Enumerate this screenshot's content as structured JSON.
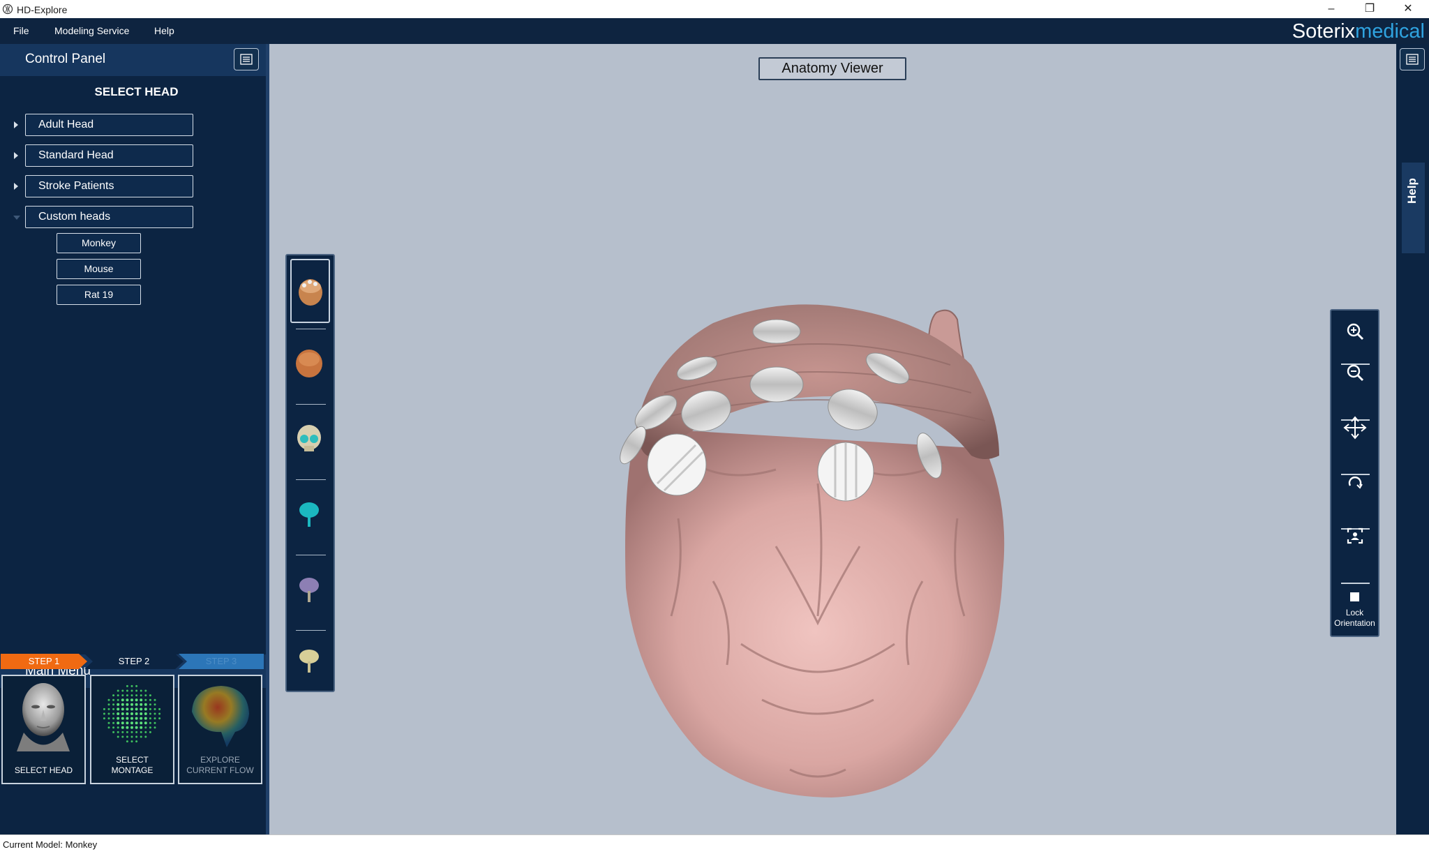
{
  "window": {
    "title": "HD-Explore",
    "controls": [
      "–",
      "❐",
      "✕"
    ]
  },
  "menubar": {
    "items": [
      "File",
      "Modeling Service",
      "Help"
    ],
    "brand_part1": "Soterix",
    "brand_part2": "medical",
    "brand_colors": {
      "part1": "#ffffff",
      "part2": "#2fa3e0"
    }
  },
  "control_panel": {
    "title": "Control Panel",
    "section_title": "SELECT HEAD",
    "head_groups": [
      {
        "label": "Adult Head",
        "expanded": false
      },
      {
        "label": "Standard Head",
        "expanded": false
      },
      {
        "label": "Stroke Patients",
        "expanded": false
      },
      {
        "label": "Custom heads",
        "expanded": true
      }
    ],
    "custom_heads": [
      "Monkey",
      "Mouse",
      "Rat 19"
    ]
  },
  "main_menu": {
    "title": "Main Menu",
    "steps": [
      {
        "label": "STEP 1",
        "state": "active",
        "color": "#f06a12"
      },
      {
        "label": "STEP 2",
        "state": "enabled"
      },
      {
        "label": "STEP 3",
        "state": "disabled"
      }
    ],
    "cards": [
      {
        "line1": "SELECT HEAD",
        "line2": ""
      },
      {
        "line1": "SELECT",
        "line2": "MONTAGE"
      },
      {
        "line1": "EXPLORE",
        "line2": "CURRENT FLOW"
      }
    ]
  },
  "viewer": {
    "title": "Anatomy Viewer",
    "thumbnails": [
      "monkey-head-skin",
      "monkey-head-bare",
      "monkey-skull",
      "brain-cyan",
      "brain-purple",
      "brain-yellow"
    ],
    "active_thumbnail": 0
  },
  "tools": {
    "items": [
      "zoom-in-icon",
      "zoom-out-icon",
      "pan-icon",
      "rotate-icon",
      "fit-view-icon"
    ],
    "lock_label_1": "Lock",
    "lock_label_2": "Orientation",
    "lock_checked": false
  },
  "right_sidebar": {
    "help_label": "Help"
  },
  "status": {
    "text": "Current Model: Monkey"
  }
}
